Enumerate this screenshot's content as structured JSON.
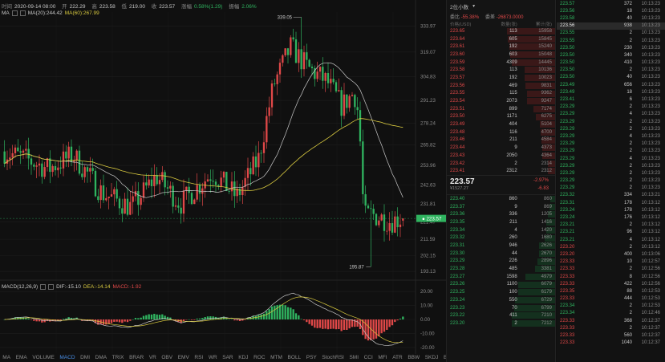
{
  "info": {
    "time_label": "时间",
    "time": "2020-09-14 08:00",
    "open_label": "开",
    "open": "222.29",
    "high_label": "高",
    "high": "223.58",
    "low_label": "低",
    "low": "219.00",
    "close_label": "收",
    "close": "223.57",
    "change_label": "涨幅",
    "change": "0.58%(1.29)",
    "amp_label": "振幅",
    "amp": "2.06%"
  },
  "ma": {
    "name": "MA",
    "ma20": "MA(20):244.42",
    "ma60": "MA(60):267.99"
  },
  "macd": {
    "name": "MACD(12,26,9)",
    "dif": "DIF:-15.10",
    "dea": "DEA:-14.14",
    "macd": "MACD:-1.92"
  },
  "colors": {
    "up": "#e04848",
    "down": "#2fb35f",
    "ma20": "#c8c8c8",
    "ma60": "#d8c93f",
    "accent": "#4a8fe7"
  },
  "price_axis": [
    "333.97",
    "319.07",
    "304.83",
    "291.23",
    "278.24",
    "265.82",
    "253.96",
    "242.63",
    "231.81",
    "221.47",
    "211.59",
    "202.15",
    "193.13"
  ],
  "price_ticks_value": [
    333.97,
    319.07,
    304.83,
    291.23,
    278.24,
    265.82,
    253.96,
    242.63,
    231.81,
    221.47,
    211.59,
    202.15,
    193.13
  ],
  "current_price_tag": "223.57",
  "high_marker": "339.05",
  "low_marker": "195.87",
  "macd_axis": [
    "20.00",
    "10.00",
    "0.00",
    "-10.00",
    "-20.00"
  ],
  "macd_ticks_value": [
    20,
    10,
    0,
    -10,
    -20
  ],
  "chart_data": {
    "type": "candlestick",
    "price_range": [
      190,
      342
    ],
    "high": 339.05,
    "low": 195.87,
    "last": 223.57,
    "candle_count": 150,
    "macd_range": [
      -23,
      23
    ]
  },
  "tabs": [
    "MA",
    "EMA",
    "VOLUME",
    "MACD",
    "DMI",
    "DMA",
    "TRIX",
    "BRAR",
    "VR",
    "OBV",
    "EMV",
    "RSI",
    "WR",
    "SAR",
    "KDJ",
    "ROC",
    "MTM",
    "BOLL",
    "PSY",
    "StochRSI",
    "SMI",
    "CCI",
    "MFI",
    "ATR",
    "BBW",
    "SKDJ",
    "BIAS"
  ],
  "active_tab": "MACD",
  "depth": {
    "precision": "2位小数",
    "ratio_label": "委比",
    "ratio": "-55.38%",
    "diff_label": "委差",
    "diff": "-26873.0000",
    "col_price": "价格(USD)",
    "col_qty": "数量(张)",
    "col_total": "累计(张)",
    "asks": [
      {
        "p": "223.65",
        "q": "113",
        "t": "15958"
      },
      {
        "p": "223.64",
        "q": "605",
        "t": "15845"
      },
      {
        "p": "223.61",
        "q": "192",
        "t": "15240"
      },
      {
        "p": "223.60",
        "q": "603",
        "t": "15048"
      },
      {
        "p": "223.59",
        "q": "4309",
        "t": "14445"
      },
      {
        "p": "223.58",
        "q": "113",
        "t": "10136"
      },
      {
        "p": "223.57",
        "q": "192",
        "t": "10023"
      },
      {
        "p": "223.56",
        "q": "469",
        "t": "9831"
      },
      {
        "p": "223.55",
        "q": "115",
        "t": "9362"
      },
      {
        "p": "223.54",
        "q": "2073",
        "t": "9247"
      },
      {
        "p": "223.51",
        "q": "899",
        "t": "7174"
      },
      {
        "p": "223.50",
        "q": "1171",
        "t": "6275"
      },
      {
        "p": "223.49",
        "q": "404",
        "t": "5104"
      },
      {
        "p": "223.48",
        "q": "116",
        "t": "4700"
      },
      {
        "p": "223.46",
        "q": "211",
        "t": "4584"
      },
      {
        "p": "223.44",
        "q": "9",
        "t": "4373"
      },
      {
        "p": "223.43",
        "q": "2050",
        "t": "4364"
      },
      {
        "p": "223.42",
        "q": "2",
        "t": "2314"
      },
      {
        "p": "223.41",
        "q": "2312",
        "t": "2312"
      }
    ],
    "mid_price": "223.57",
    "mid_sub": "¥1527.27",
    "mid_pct": "-2.97%",
    "mid_chg": "-6.83",
    "bids": [
      {
        "p": "223.40",
        "q": "860",
        "t": "860"
      },
      {
        "p": "223.37",
        "q": "9",
        "t": "869"
      },
      {
        "p": "223.36",
        "q": "336",
        "t": "1205"
      },
      {
        "p": "223.35",
        "q": "211",
        "t": "1416"
      },
      {
        "p": "223.34",
        "q": "4",
        "t": "1420"
      },
      {
        "p": "223.32",
        "q": "260",
        "t": "1680"
      },
      {
        "p": "223.31",
        "q": "946",
        "t": "2626"
      },
      {
        "p": "223.30",
        "q": "44",
        "t": "2670"
      },
      {
        "p": "223.29",
        "q": "226",
        "t": "2896"
      },
      {
        "p": "223.28",
        "q": "485",
        "t": "3381"
      },
      {
        "p": "223.27",
        "q": "1598",
        "t": "4979"
      },
      {
        "p": "223.26",
        "q": "1100",
        "t": "6079"
      },
      {
        "p": "223.25",
        "q": "100",
        "t": "6179"
      },
      {
        "p": "223.24",
        "q": "550",
        "t": "6729"
      },
      {
        "p": "223.23",
        "q": "70",
        "t": "6799"
      },
      {
        "p": "223.22",
        "q": "411",
        "t": "7210"
      },
      {
        "p": "223.20",
        "q": "2",
        "t": "7212"
      }
    ]
  },
  "trades": [
    {
      "p": "223.57",
      "q": "372",
      "t": "10:13:23",
      "s": "dn"
    },
    {
      "p": "223.56",
      "q": "18",
      "t": "10:13:23",
      "s": "dn"
    },
    {
      "p": "223.58",
      "q": "40",
      "t": "10:13:23",
      "s": "dn"
    },
    {
      "p": "223.56",
      "q": "938",
      "t": "10:13:23",
      "s": "hl"
    },
    {
      "p": "223.55",
      "q": "2",
      "t": "10:13:23",
      "s": "dn"
    },
    {
      "p": "223.55",
      "q": "2",
      "t": "10:13:23",
      "s": "dn"
    },
    {
      "p": "223.50",
      "q": "230",
      "t": "10:13:23",
      "s": "dn"
    },
    {
      "p": "223.50",
      "q": "340",
      "t": "10:13:23",
      "s": "dn"
    },
    {
      "p": "223.50",
      "q": "410",
      "t": "10:13:23",
      "s": "dn"
    },
    {
      "p": "223.50",
      "q": "2",
      "t": "10:13:23",
      "s": "dn"
    },
    {
      "p": "223.50",
      "q": "40",
      "t": "10:13:23",
      "s": "dn"
    },
    {
      "p": "223.49",
      "q": "656",
      "t": "10:13:23",
      "s": "dn"
    },
    {
      "p": "223.49",
      "q": "18",
      "t": "10:13:23",
      "s": "dn"
    },
    {
      "p": "223.41",
      "q": "6",
      "t": "10:13:23",
      "s": "dn"
    },
    {
      "p": "223.29",
      "q": "2",
      "t": "10:13:23",
      "s": "dn"
    },
    {
      "p": "223.29",
      "q": "4",
      "t": "10:13:23",
      "s": "dn"
    },
    {
      "p": "223.29",
      "q": "2",
      "t": "10:13:23",
      "s": "dn"
    },
    {
      "p": "223.29",
      "q": "2",
      "t": "10:13:23",
      "s": "dn"
    },
    {
      "p": "223.29",
      "q": "4",
      "t": "10:13:23",
      "s": "dn"
    },
    {
      "p": "223.29",
      "q": "2",
      "t": "10:13:23",
      "s": "dn"
    },
    {
      "p": "223.29",
      "q": "2",
      "t": "10:13:23",
      "s": "dn"
    },
    {
      "p": "223.29",
      "q": "4",
      "t": "10:13:23",
      "s": "dn"
    },
    {
      "p": "223.29",
      "q": "2",
      "t": "10:13:23",
      "s": "dn"
    },
    {
      "p": "223.29",
      "q": "2",
      "t": "10:13:23",
      "s": "dn"
    },
    {
      "p": "223.29",
      "q": "2",
      "t": "10:13:23",
      "s": "dn"
    },
    {
      "p": "223.29",
      "q": "2",
      "t": "10:13:23",
      "s": "dn"
    },
    {
      "p": "223.32",
      "q": "334",
      "t": "10:13:21",
      "s": "dn"
    },
    {
      "p": "223.31",
      "q": "178",
      "t": "10:13:12",
      "s": "dn"
    },
    {
      "p": "223.24",
      "q": "178",
      "t": "10:13:12",
      "s": "dn"
    },
    {
      "p": "223.24",
      "q": "176",
      "t": "10:13:12",
      "s": "dn"
    },
    {
      "p": "223.21",
      "q": "2",
      "t": "10:13:12",
      "s": "dn"
    },
    {
      "p": "223.21",
      "q": "96",
      "t": "10:13:12",
      "s": "dn"
    },
    {
      "p": "223.21",
      "q": "4",
      "t": "10:13:12",
      "s": "dn"
    },
    {
      "p": "223.20",
      "q": "2",
      "t": "10:13:12",
      "s": "up"
    },
    {
      "p": "223.20",
      "q": "400",
      "t": "10:13:06",
      "s": "up"
    },
    {
      "p": "223.33",
      "q": "10",
      "t": "10:12:57",
      "s": "up"
    },
    {
      "p": "223.33",
      "q": "2",
      "t": "10:12:56",
      "s": "up"
    },
    {
      "p": "223.33",
      "q": "8",
      "t": "10:12:56",
      "s": "up"
    },
    {
      "p": "223.33",
      "q": "422",
      "t": "10:12:56",
      "s": "up"
    },
    {
      "p": "223.35",
      "q": "88",
      "t": "10:12:53",
      "s": "up"
    },
    {
      "p": "223.33",
      "q": "444",
      "t": "10:12:53",
      "s": "up"
    },
    {
      "p": "223.34",
      "q": "2",
      "t": "10:12:53",
      "s": "dn"
    },
    {
      "p": "223.34",
      "q": "2",
      "t": "10:12:46",
      "s": "dn"
    },
    {
      "p": "223.33",
      "q": "368",
      "t": "10:12:37",
      "s": "up"
    },
    {
      "p": "223.33",
      "q": "2",
      "t": "10:12:37",
      "s": "up"
    },
    {
      "p": "223.33",
      "q": "560",
      "t": "10:12:37",
      "s": "up"
    },
    {
      "p": "223.33",
      "q": "1040",
      "t": "10:12:37",
      "s": "up"
    }
  ]
}
